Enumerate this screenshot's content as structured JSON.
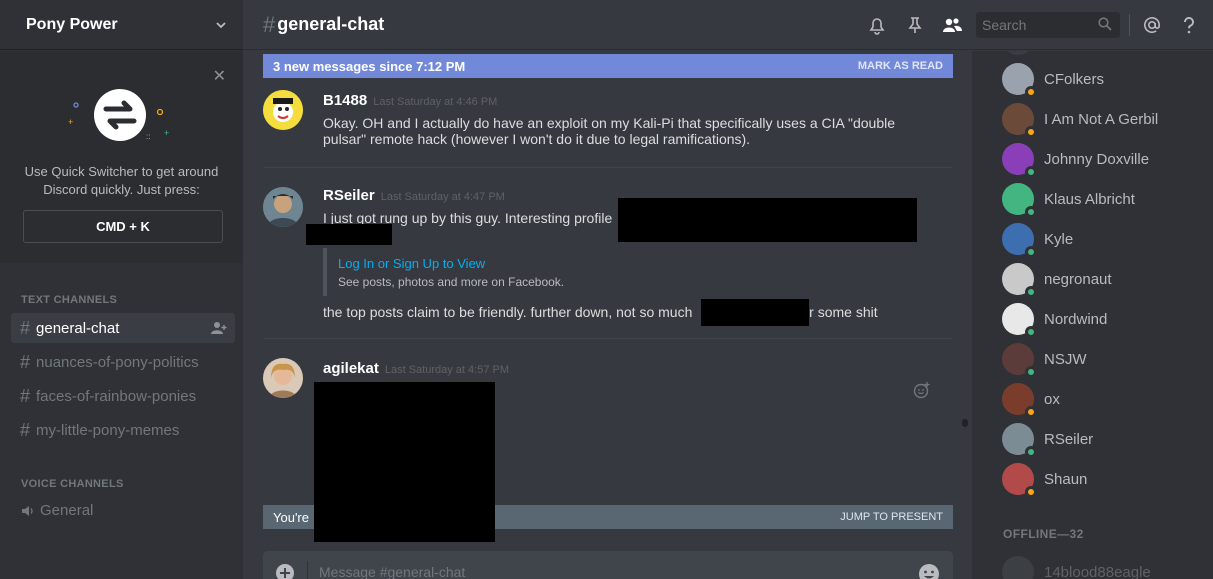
{
  "server": {
    "name": "Pony Power"
  },
  "quick_switcher": {
    "text": "Use Quick Switcher to get around Discord quickly. Just press:",
    "shortcut": "CMD + K"
  },
  "categories": {
    "text": "TEXT CHANNELS",
    "voice": "VOICE CHANNELS"
  },
  "channels": [
    {
      "name": "general-chat",
      "active": true
    },
    {
      "name": "nuances-of-pony-politics",
      "active": false
    },
    {
      "name": "faces-of-rainbow-ponies",
      "active": false
    },
    {
      "name": "my-little-pony-memes",
      "active": false
    }
  ],
  "voice_channels": [
    {
      "name": "General"
    }
  ],
  "header": {
    "channel": "general-chat",
    "search_placeholder": "Search"
  },
  "new_messages": {
    "text": "3 new messages since 7:12 PM",
    "action": "MARK AS READ"
  },
  "messages": [
    {
      "author": "B1488",
      "timestamp": "Last Saturday at 4:46 PM",
      "lines": [
        "Okay. OH and I actually do have an exploit on my Kali-Pi that specifically uses a CIA \"double",
        "pulsar\" remote hack (however I won't do it due to legal ramifications)."
      ]
    },
    {
      "author": "RSeiler",
      "timestamp": "Last Saturday at 4:47 PM",
      "line1": "I just got rung up by this guy.  Interesting profile",
      "embed": {
        "link": "Log In or Sign Up to View",
        "desc": "See posts, photos and more on Facebook."
      },
      "line2a": "the top posts claim to be friendly.  further down, not so much",
      "line2b": "or some shit"
    },
    {
      "author": "agilekat",
      "timestamp": "Last Saturday at 4:57 PM"
    }
  ],
  "jump_bar": {
    "text": "You're",
    "action": "JUMP TO PRESENT"
  },
  "composer": {
    "placeholder": "Message #general-chat"
  },
  "members": [
    {
      "name": "CFolkers",
      "status": "idle",
      "color": "#9aa3ad"
    },
    {
      "name": "I Am Not A Gerbil",
      "status": "idle",
      "color": "#6b4a3a"
    },
    {
      "name": "Johnny Doxville",
      "status": "online",
      "color": "#8a3fb8"
    },
    {
      "name": "Klaus Albricht",
      "status": "online",
      "color": "#43b581"
    },
    {
      "name": "Kyle",
      "status": "online",
      "color": "#3d6fb0"
    },
    {
      "name": "negronaut",
      "status": "online",
      "color": "#c9c9c9"
    },
    {
      "name": "Nordwind",
      "status": "online",
      "color": "#e8e8e8"
    },
    {
      "name": "NSJW",
      "status": "online",
      "color": "#5c3b3b"
    },
    {
      "name": "ox",
      "status": "idle",
      "color": "#7a3d2c"
    },
    {
      "name": "RSeiler",
      "status": "online",
      "color": "#7c8c95"
    },
    {
      "name": "Shaun",
      "status": "idle",
      "color": "#b34a4a"
    }
  ],
  "offline": {
    "label": "OFFLINE—32",
    "first": "14blood88eagle"
  },
  "colors": {
    "online": "#43b581",
    "idle": "#faa61a",
    "accent": "#7289da"
  }
}
